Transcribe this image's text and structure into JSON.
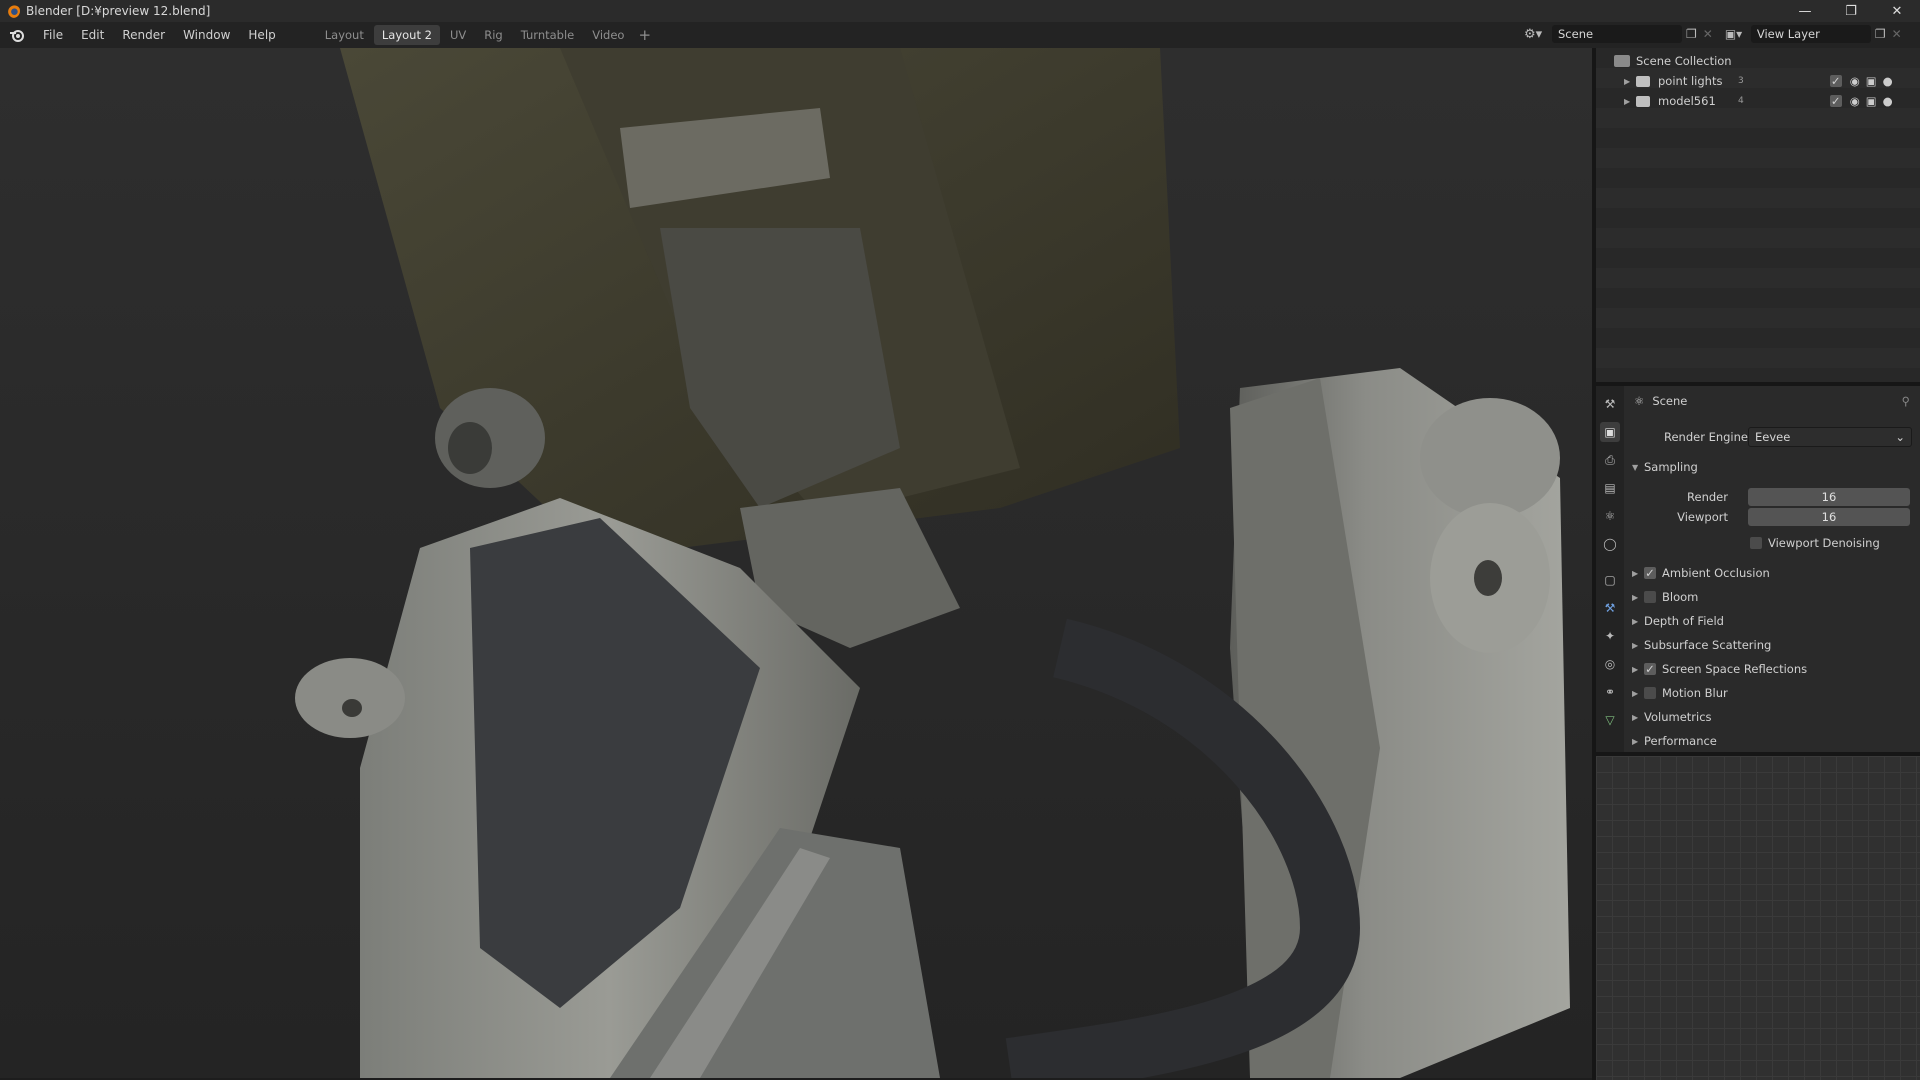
{
  "window": {
    "title": "Blender [D:¥preview 12.blend]",
    "controls": [
      "minimize-icon",
      "restore-icon",
      "close-icon"
    ]
  },
  "menubar": {
    "menus": [
      "File",
      "Edit",
      "Render",
      "Window",
      "Help"
    ],
    "workspaces": [
      "Layout",
      "Layout 2",
      "UV",
      "Rig",
      "Turntable",
      "Video"
    ],
    "active_workspace": "Layout 2",
    "add_workspace": "+",
    "scene": "Scene",
    "view_layer": "View Layer"
  },
  "outliner": {
    "root": "Scene Collection",
    "items": [
      {
        "label": "point lights",
        "badge": "3"
      },
      {
        "label": "model561",
        "badge": "4"
      }
    ]
  },
  "properties": {
    "context": "Scene",
    "render_engine_label": "Render Engine",
    "render_engine": "Eevee",
    "sampling": {
      "title": "Sampling",
      "render_label": "Render",
      "render_value": "16",
      "viewport_label": "Viewport",
      "viewport_value": "16",
      "denoise_label": "Viewport Denoising"
    },
    "panels": [
      {
        "label": "Ambient Occlusion",
        "checkbox": true,
        "checked": true
      },
      {
        "label": "Bloom",
        "checkbox": true,
        "checked": false
      },
      {
        "label": "Depth of Field",
        "checkbox": false,
        "checked": false
      },
      {
        "label": "Subsurface Scattering",
        "checkbox": false,
        "checked": false
      },
      {
        "label": "Screen Space Reflections",
        "checkbox": true,
        "checked": true
      },
      {
        "label": "Motion Blur",
        "checkbox": true,
        "checked": false
      },
      {
        "label": "Volumetrics",
        "checkbox": false,
        "checked": false
      },
      {
        "label": "Performance",
        "checkbox": false,
        "checked": false
      }
    ]
  },
  "colors": {
    "accent": "#e87d0d",
    "panel_bg": "#2a2a2a",
    "field_bg": "#545454"
  }
}
